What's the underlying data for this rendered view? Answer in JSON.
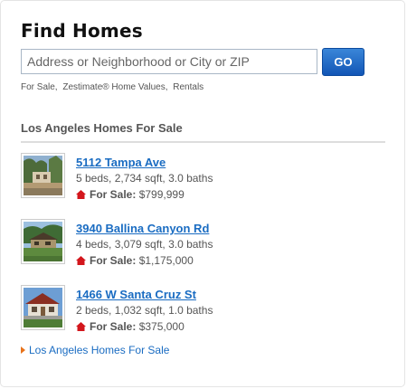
{
  "widget": {
    "title": "Find Homes",
    "search": {
      "placeholder": "Address or Neighborhood or City or ZIP",
      "go_label": "GO"
    },
    "search_types": [
      "For Sale,",
      "Zestimate® Home Values,",
      "Rentals"
    ]
  },
  "section": {
    "heading": "Los Angeles Homes For Sale"
  },
  "listings": [
    {
      "address": "5112 Tampa Ave",
      "details": "5 beds, 2,734 sqft, 3.0 baths",
      "status_label": "For Sale:",
      "price": "$799,999"
    },
    {
      "address": "3940 Ballina Canyon Rd",
      "details": "4 beds, 3,079 sqft, 3.0 baths",
      "status_label": "For Sale:",
      "price": "$1,175,000"
    },
    {
      "address": "1466 W Santa Cruz St",
      "details": "2 beds, 1,032 sqft, 1.0 baths",
      "status_label": "For Sale:",
      "price": "$375,000"
    }
  ],
  "footer": {
    "link_text": "Los Angeles Homes For Sale"
  },
  "icons": {
    "status": "house-icon",
    "footer": "arrow-right-icon"
  },
  "colors": {
    "link": "#1a6cc2",
    "go_button": "#1256b6",
    "for_sale_icon": "#d3161c",
    "footer_arrow": "#e8731b"
  }
}
